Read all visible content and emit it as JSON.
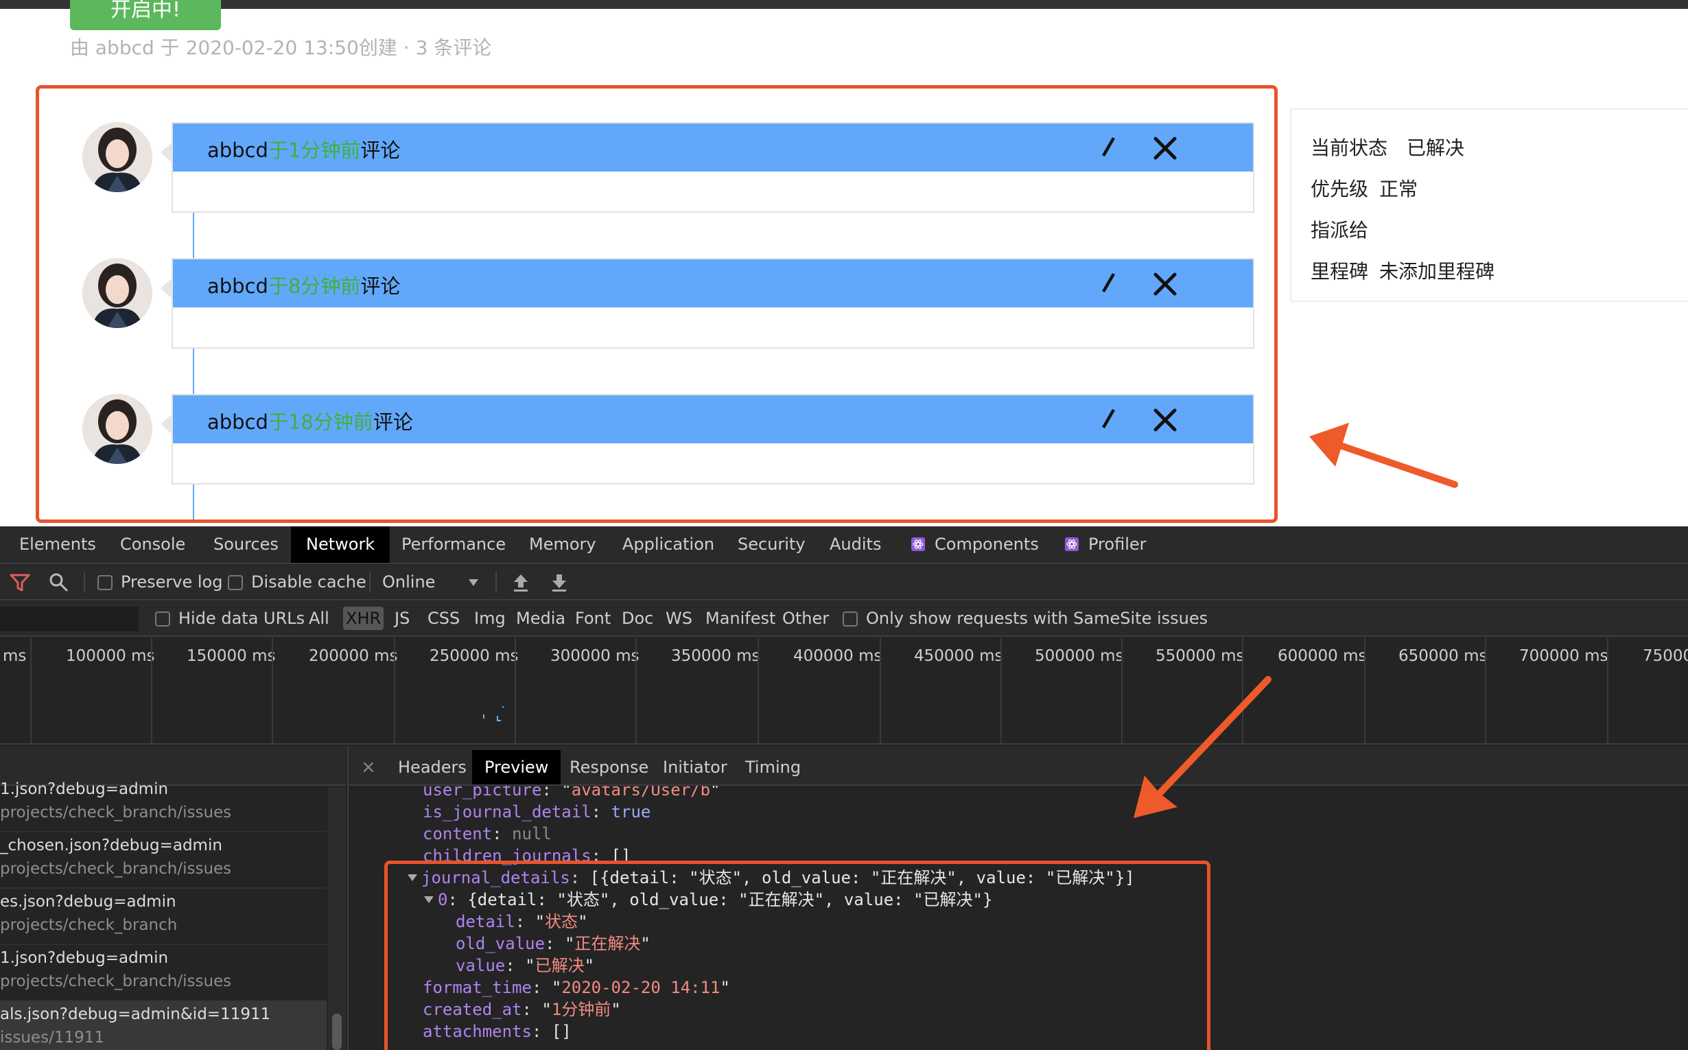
{
  "issue": {
    "status_button": "开启中!",
    "meta": "由 abbcd 于 2020-02-20 13:50创建 · 3 条评论"
  },
  "comments": [
    {
      "author": "abbcd",
      "time": "于1分钟前",
      "suffix": "评论"
    },
    {
      "author": "abbcd",
      "time": "于8分钟前",
      "suffix": "评论"
    },
    {
      "author": "abbcd",
      "time": "于18分钟前",
      "suffix": "评论"
    }
  ],
  "side_panel": {
    "rows": [
      {
        "key": "当前状态",
        "value": "已解决"
      },
      {
        "key": "优先级",
        "value": "正常"
      },
      {
        "key": "指派给",
        "value": ""
      },
      {
        "key": "里程碑",
        "value": "未添加里程碑"
      }
    ]
  },
  "devtools": {
    "tabs": [
      "Elements",
      "Console",
      "Sources",
      "Network",
      "Performance",
      "Memory",
      "Application",
      "Security",
      "Audits",
      "Components",
      "Profiler"
    ],
    "active_tab": "Network",
    "toolbar": {
      "preserve_log": "Preserve log",
      "disable_cache": "Disable cache",
      "throttle": "Online"
    },
    "filter": {
      "hide_data_urls": "Hide data URLs",
      "types": [
        "All",
        "XHR",
        "JS",
        "CSS",
        "Img",
        "Media",
        "Font",
        "Doc",
        "WS",
        "Manifest",
        "Other"
      ],
      "active_type": "XHR",
      "samesite": "Only show requests with SameSite issues"
    },
    "timeline_ticks": [
      "ms",
      "100000 ms",
      "150000 ms",
      "200000 ms",
      "250000 ms",
      "300000 ms",
      "350000 ms",
      "400000 ms",
      "450000 ms",
      "500000 ms",
      "550000 ms",
      "600000 ms",
      "650000 ms",
      "700000 ms",
      "75000"
    ],
    "requests": [
      {
        "name": "1.json?debug=admin",
        "path": "projects/check_branch/issues"
      },
      {
        "name": "_chosen.json?debug=admin",
        "path": "projects/check_branch/issues"
      },
      {
        "name": "es.json?debug=admin",
        "path": "projects/check_branch"
      },
      {
        "name": "1.json?debug=admin",
        "path": "projects/check_branch/issues"
      },
      {
        "name": "als.json?debug=admin&id=11911",
        "path": "issues/11911"
      }
    ],
    "detail_tabs": [
      "Headers",
      "Preview",
      "Response",
      "Initiator",
      "Timing"
    ],
    "active_detail_tab": "Preview",
    "preview": {
      "user_picture_key": "user_picture",
      "user_picture_val": "avatars/User/b",
      "is_journal_detail_key": "is_journal_detail",
      "is_journal_detail_val": "true",
      "content_key": "content",
      "content_val": "null",
      "children_journals_key": "children_journals",
      "children_journals_val": "[]",
      "journal_details_key": "journal_details",
      "journal_details_summary": "[{detail: \"状态\", old_value: \"正在解决\", value: \"已解决\"}]",
      "item0_key": "0",
      "item0_summary": "{detail: \"状态\", old_value: \"正在解决\", value: \"已解决\"}",
      "detail_key": "detail",
      "detail_val": "状态",
      "old_value_key": "old_value",
      "old_value_val": "正在解决",
      "value_key": "value",
      "value_val": "已解决",
      "format_time_key": "format_time",
      "format_time_val": "2020-02-20 14:11",
      "created_at_key": "created_at",
      "created_at_val": "1分钟前",
      "attachments_key": "attachments",
      "attachments_val": "[]"
    }
  },
  "colors": {
    "highlight_box": "#e8532c",
    "comment_header": "#62a8fa",
    "time_green": "#3fb13f",
    "status_green": "#5cb85c"
  }
}
